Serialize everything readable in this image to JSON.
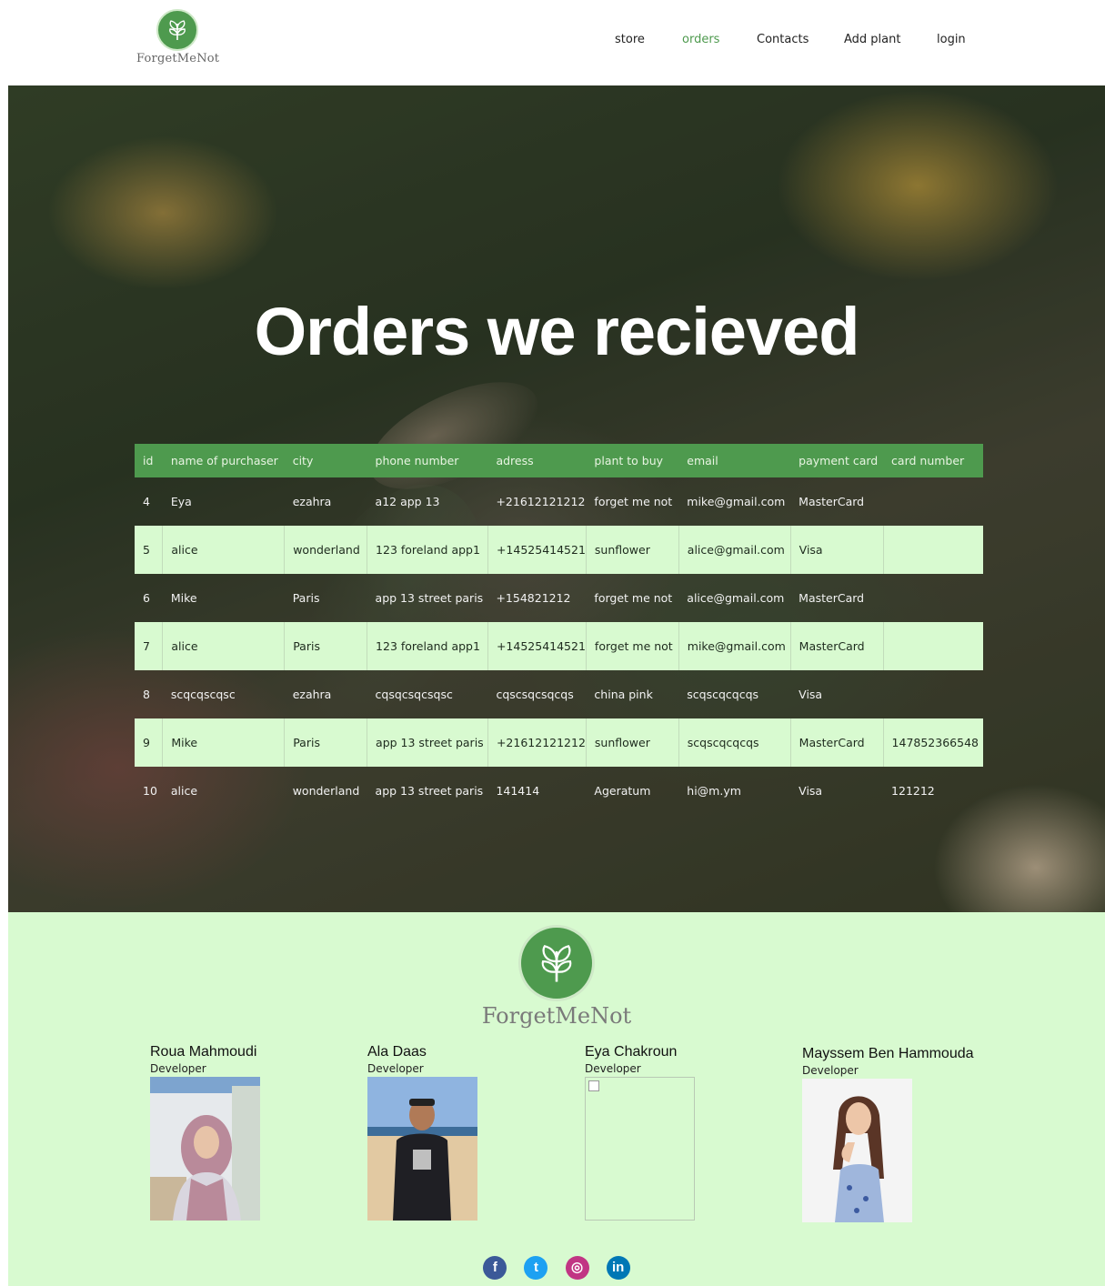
{
  "header": {
    "brand": "ForgetMeNot",
    "nav": [
      {
        "label": "store",
        "active": false
      },
      {
        "label": "orders",
        "active": true
      },
      {
        "label": "Contacts",
        "active": false
      },
      {
        "label": "Add plant",
        "active": false
      },
      {
        "label": "login",
        "active": false
      }
    ]
  },
  "hero": {
    "title": "Orders we recieved"
  },
  "orders": {
    "columns": [
      "id",
      "name of purchaser",
      "city",
      "phone number",
      "adress",
      "plant to buy",
      "email",
      "payment card",
      "card number"
    ],
    "rows": [
      [
        "4",
        "Eya",
        "ezahra",
        "a12 app 13",
        "+21612121212",
        "forget me not",
        "mike@gmail.com",
        "MasterCard",
        ""
      ],
      [
        "5",
        "alice",
        "wonderland",
        "123 foreland app1",
        "+14525414521",
        "sunflower",
        "alice@gmail.com",
        "Visa",
        ""
      ],
      [
        "6",
        "Mike",
        "Paris",
        "app 13 street paris",
        "+154821212",
        "forget me not",
        "alice@gmail.com",
        "MasterCard",
        ""
      ],
      [
        "7",
        "alice",
        "Paris",
        "123 foreland app1",
        "+14525414521",
        "forget me not",
        "mike@gmail.com",
        "MasterCard",
        ""
      ],
      [
        "8",
        "scqcqscqsc",
        "ezahra",
        "cqsqcsqcsqsc",
        "cqscsqcsqcqs",
        "china pink",
        "scqscqcqcqs",
        "Visa",
        ""
      ],
      [
        "9",
        "Mike",
        "Paris",
        "app 13 street paris",
        "+21612121212",
        "sunflower",
        "scqscqcqcqs",
        "MasterCard",
        "147852366548"
      ],
      [
        "10",
        "alice",
        "wonderland",
        "app 13 street paris",
        "141414",
        "Ageratum",
        "hi@m.ym",
        "Visa",
        "121212"
      ]
    ]
  },
  "footer": {
    "brand": "ForgetMeNot",
    "team": [
      {
        "name": "Roua Mahmoudi",
        "role": "Developer",
        "photo": "portrait"
      },
      {
        "name": "Ala Daas",
        "role": "Developer",
        "photo": "portrait"
      },
      {
        "name": "Eya Chakroun",
        "role": "Developer",
        "photo": "broken-image"
      },
      {
        "name": "Mayssem Ben Hammouda",
        "role": "Developer",
        "photo": "portrait"
      }
    ],
    "socials": [
      {
        "icon": "facebook-icon",
        "glyph": "f",
        "color": "#3b5998"
      },
      {
        "icon": "twitter-icon",
        "glyph": "t",
        "color": "#1da1f2"
      },
      {
        "icon": "instagram-icon",
        "glyph": "◎",
        "color": "#c13584"
      },
      {
        "icon": "linkedin-icon",
        "glyph": "in",
        "color": "#0077b5"
      }
    ]
  },
  "colors": {
    "brand_green": "#4e9a4e",
    "row_alt": "#d8fad0",
    "footer_bg": "#d8fad0"
  }
}
